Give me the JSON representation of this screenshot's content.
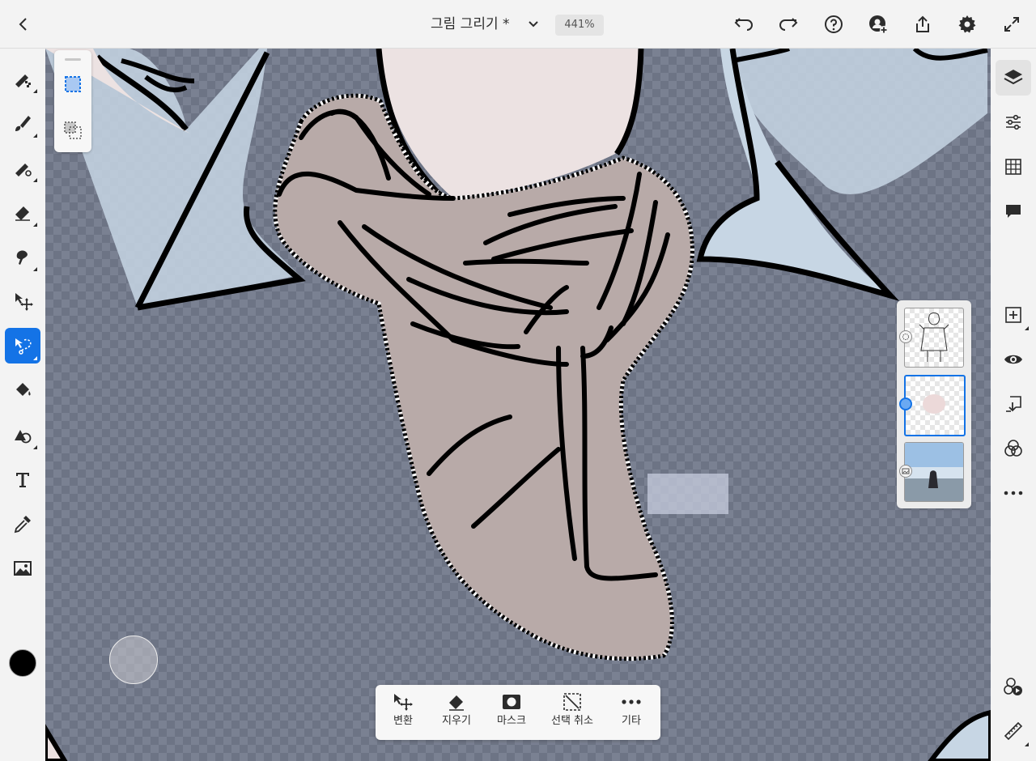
{
  "header": {
    "document_title": "그림 그리기 *",
    "zoom": "441%"
  },
  "bottom_actions": [
    {
      "label": "변환",
      "icon": "transform-icon"
    },
    {
      "label": "지우기",
      "icon": "erase-icon"
    },
    {
      "label": "마스크",
      "icon": "mask-icon"
    },
    {
      "label": "선택 취소",
      "icon": "deselect-icon"
    },
    {
      "label": "기타",
      "icon": "more-icon"
    }
  ],
  "left_tools": [
    "pixel-brush-icon",
    "live-brush-icon",
    "vector-brush-icon",
    "eraser-icon",
    "smudge-icon",
    "move-icon",
    "lasso-select-icon",
    "fill-icon",
    "shape-icon",
    "text-icon",
    "eyedropper-icon",
    "image-icon"
  ],
  "active_tool": "lasso-select-icon",
  "current_color": "#000000",
  "right_tools": [
    "layers-icon",
    "adjustments-icon",
    "grid-icon",
    "comment-icon",
    "add-layer-icon",
    "visibility-icon",
    "merge-down-icon",
    "blend-icon",
    "more-icon",
    "recording-icon",
    "ruler-icon"
  ],
  "layers": [
    {
      "type": "drawing",
      "badge": "pixel-layer-icon"
    },
    {
      "type": "drawing",
      "badge": "selected-indicator",
      "selected": true
    },
    {
      "type": "photo",
      "badge": "image-layer-icon"
    }
  ],
  "colors": {
    "accent": "#1473e6",
    "canvas_background": "#6d7485",
    "skin": "#ece2e2",
    "cloth": "#b8aaa8"
  }
}
